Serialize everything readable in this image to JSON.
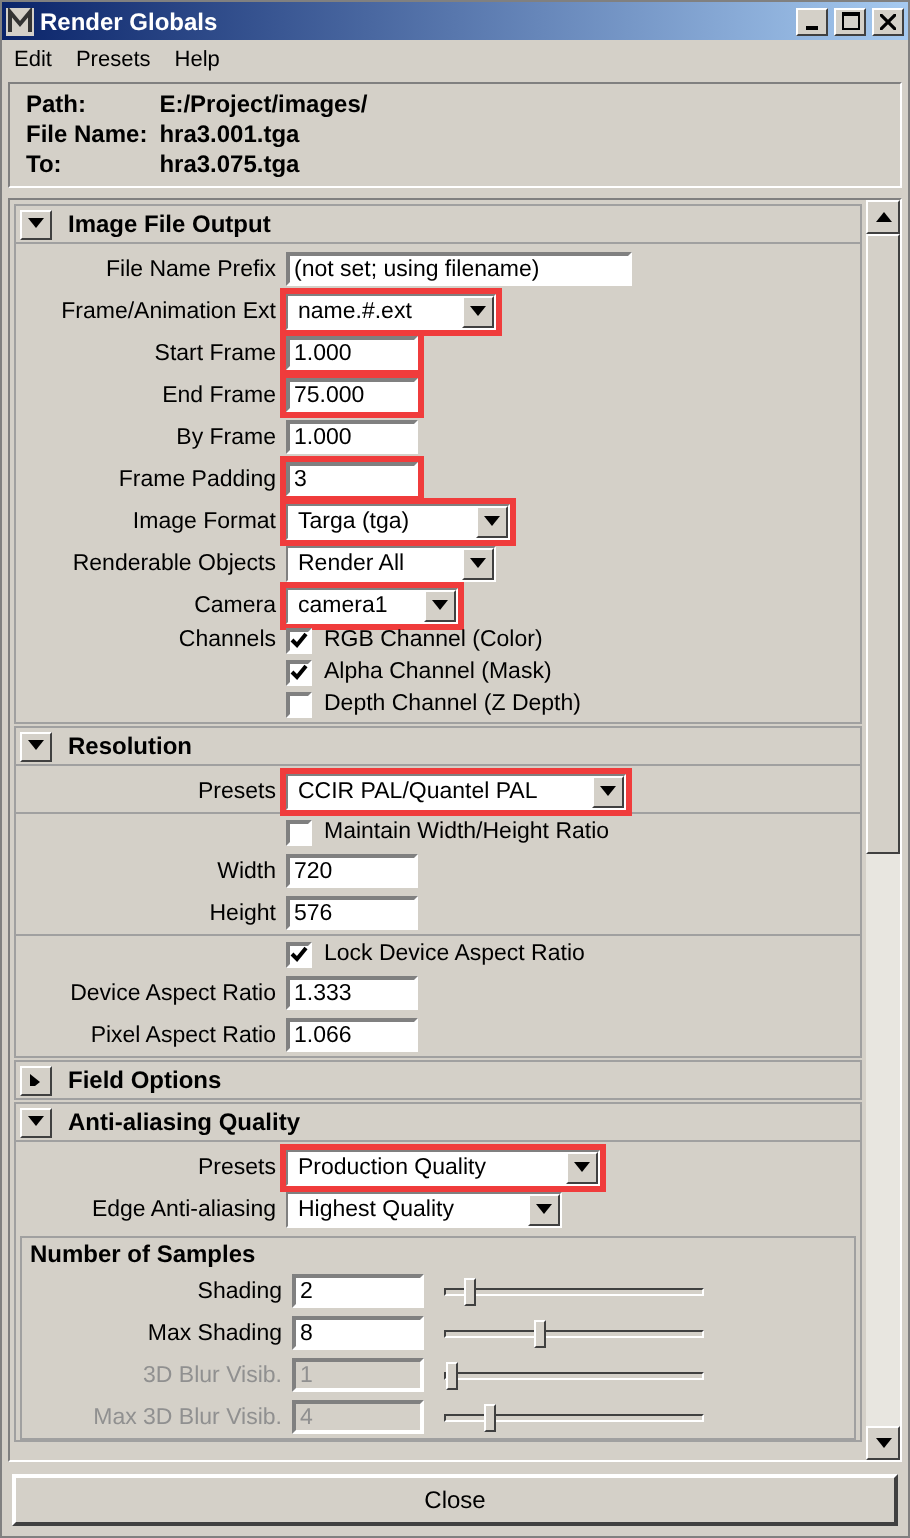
{
  "window": {
    "title": "Render Globals"
  },
  "menu": [
    "Edit",
    "Presets",
    "Help"
  ],
  "info": [
    {
      "label": "Path:",
      "value": "E:/Project/images/"
    },
    {
      "label": "File Name:",
      "value": "hra3.001.tga"
    },
    {
      "label": "To:",
      "value": "hra3.075.tga"
    }
  ],
  "sections": [
    {
      "title": "Image File Output",
      "expanded": true,
      "groups": [
        [
          {
            "kind": "text",
            "label": "File Name Prefix",
            "value": "(not set; using filename)",
            "highlighted": false
          },
          {
            "kind": "dropdown",
            "label": "Frame/Animation Ext",
            "value": "name.#.ext",
            "highlighted": true
          },
          {
            "kind": "text",
            "label": "Start Frame",
            "value": "1.000",
            "highlighted": true
          },
          {
            "kind": "text",
            "label": "End Frame",
            "value": "75.000",
            "highlighted": true
          },
          {
            "kind": "text",
            "label": "By Frame",
            "value": "1.000",
            "highlighted": false
          },
          {
            "kind": "text",
            "label": "Frame Padding",
            "value": "3",
            "highlighted": true
          },
          {
            "kind": "dropdown",
            "label": "Image Format",
            "value": "Targa (tga)",
            "highlighted": true
          },
          {
            "kind": "dropdown",
            "label": "Renderable Objects",
            "value": "Render All",
            "highlighted": false
          },
          {
            "kind": "dropdown",
            "label": "Camera",
            "value": "camera1",
            "highlighted": true
          },
          {
            "kind": "checkbox",
            "label": "Channels",
            "text": "RGB Channel (Color)",
            "checked": true
          },
          {
            "kind": "checkbox",
            "text": "Alpha Channel (Mask)",
            "checked": true
          },
          {
            "kind": "checkbox",
            "text": "Depth Channel (Z Depth)",
            "checked": false
          }
        ]
      ]
    },
    {
      "title": "Resolution",
      "expanded": true,
      "groups": [
        [
          {
            "kind": "dropdown",
            "label": "Presets",
            "value": "CCIR PAL/Quantel PAL",
            "highlighted": true
          }
        ],
        [
          {
            "kind": "checkbox",
            "text": "Maintain Width/Height Ratio",
            "checked": false
          },
          {
            "kind": "text",
            "label": "Width",
            "value": "720",
            "highlighted": false
          },
          {
            "kind": "text",
            "label": "Height",
            "value": "576",
            "highlighted": false
          }
        ],
        [
          {
            "kind": "checkbox",
            "text": "Lock Device Aspect Ratio",
            "checked": true
          },
          {
            "kind": "text",
            "label": "Device Aspect Ratio",
            "value": "1.333",
            "highlighted": false
          },
          {
            "kind": "text",
            "label": "Pixel Aspect Ratio",
            "value": "1.066",
            "highlighted": false
          }
        ]
      ]
    },
    {
      "title": "Field Options",
      "expanded": false
    },
    {
      "title": "Anti-aliasing Quality",
      "expanded": true,
      "groups": [
        [
          {
            "kind": "dropdown",
            "label": "Presets",
            "value": "Production Quality",
            "highlighted": true
          },
          {
            "kind": "dropdown",
            "label": "Edge Anti-aliasing",
            "value": "Highest Quality",
            "highlighted": false
          }
        ]
      ],
      "frame": {
        "title": "Number of Samples",
        "rows": [
          {
            "kind": "slider",
            "label": "Shading",
            "value": "2",
            "level": 0.1,
            "disabled": false
          },
          {
            "kind": "slider",
            "label": "Max Shading",
            "value": "8",
            "level": 0.37,
            "disabled": false
          },
          {
            "kind": "slider",
            "label": "3D Blur Visib.",
            "value": "1",
            "level": 0.03,
            "disabled": true
          },
          {
            "kind": "slider",
            "label": "Max 3D Blur Visib.",
            "value": "4",
            "level": 0.18,
            "disabled": true
          }
        ]
      }
    }
  ],
  "close": "Close"
}
